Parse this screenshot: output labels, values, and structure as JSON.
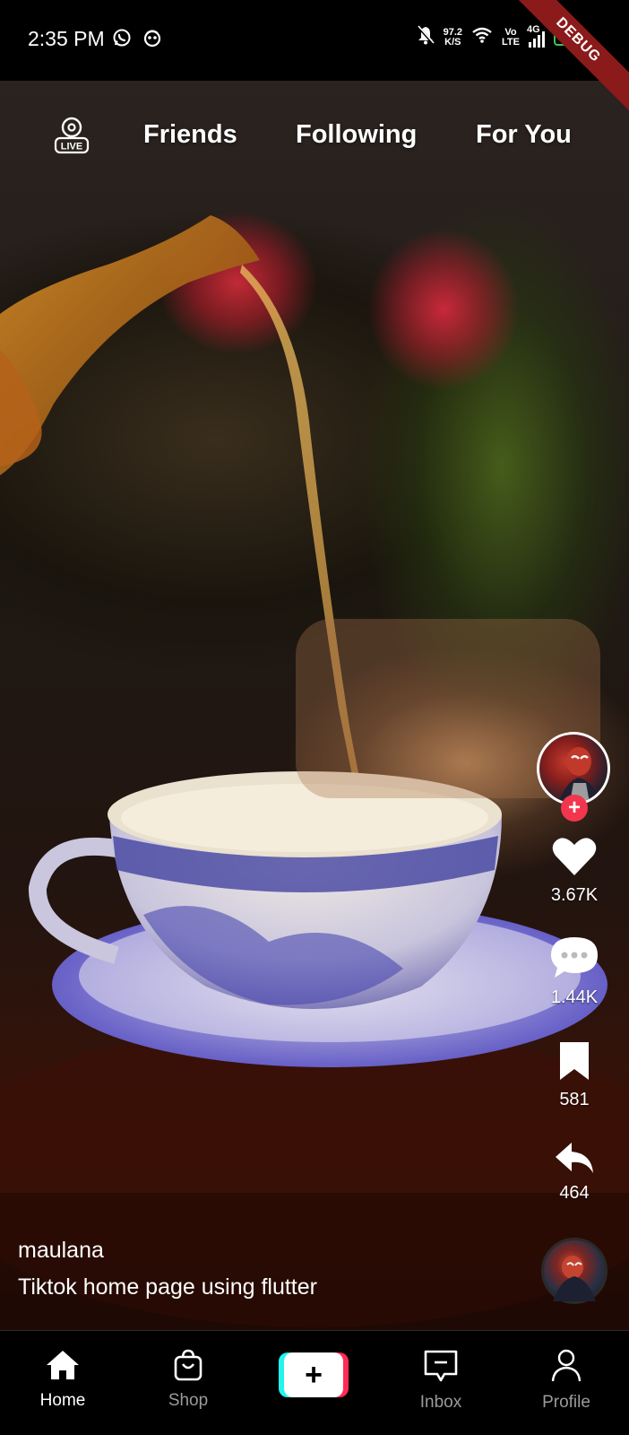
{
  "status_bar": {
    "time": "2:35 PM",
    "net_speed_value": "97.2",
    "net_speed_unit": "K/S",
    "volte_top": "Vo",
    "volte_bottom": "LTE",
    "network": "4G",
    "battery": "5",
    "debug_banner": "DEBUG",
    "icons": [
      "whatsapp-icon",
      "notification-app-icon",
      "mute-icon",
      "wifi-icon",
      "signal-icon",
      "battery-icon"
    ]
  },
  "top_tabs": {
    "live_icon": "live-icon",
    "live_label": "LIVE",
    "items": [
      "Friends",
      "Following",
      "For You"
    ]
  },
  "actions": {
    "likes": "3.67K",
    "comments": "1.44K",
    "saves": "581",
    "shares": "464",
    "follow_symbol": "+"
  },
  "caption": {
    "username": "maulana",
    "description": "Tiktok home page using flutter"
  },
  "bottom_nav": {
    "items": [
      {
        "label": "Home",
        "icon": "home-icon",
        "active": true
      },
      {
        "label": "Shop",
        "icon": "shop-icon",
        "active": false
      },
      {
        "label": "",
        "icon": "create-icon",
        "active": false
      },
      {
        "label": "Inbox",
        "icon": "inbox-icon",
        "active": false
      },
      {
        "label": "Profile",
        "icon": "profile-icon",
        "active": false
      }
    ],
    "create_symbol": "+"
  },
  "colors": {
    "accent_red": "#fe2c55",
    "accent_cyan": "#25f4ee",
    "battery_green": "#3ec34c",
    "inactive_gray": "#9a9a9a"
  }
}
